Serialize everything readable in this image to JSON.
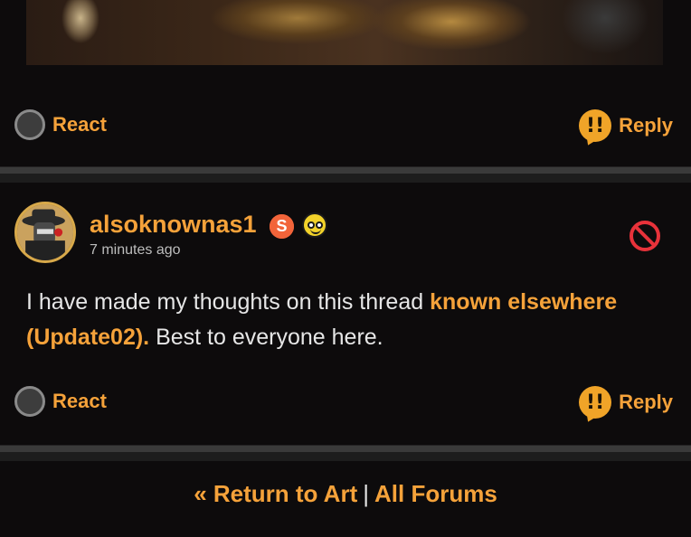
{
  "post1": {
    "react_label": "React",
    "reply_label": "Reply"
  },
  "post2": {
    "username": "alsoknownas1",
    "badge_letter": "S",
    "timestamp": "7 minutes ago",
    "body_prefix": "I have made my thoughts on this thread ",
    "link_text": "known elsewhere (Update02).",
    "body_suffix": " Best to everyone here.",
    "react_label": "React",
    "reply_label": "Reply"
  },
  "footer": {
    "return_label": "« Return to Art",
    "separator": "|",
    "all_forums_label": "All Forums"
  },
  "colors": {
    "accent": "#f5a23a",
    "background": "#0d0b0c",
    "badge_s": "#f2643a",
    "block_icon": "#e8323a"
  },
  "icons": [
    "react-icon",
    "reply-icon",
    "staff-badge-icon",
    "smiley-badge-icon",
    "block-icon"
  ]
}
